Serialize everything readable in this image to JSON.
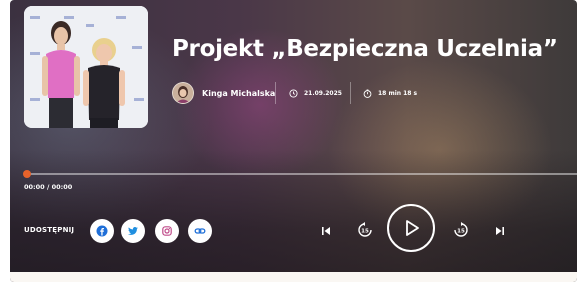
{
  "episode": {
    "title": "Projekt „Bezpieczna Uczelnia”",
    "author": "Kinga Michalska",
    "date": "21.09.2025",
    "duration": "18 min 18 s"
  },
  "player": {
    "time_readout": "00:00 / 00:00",
    "progress": 0
  },
  "share": {
    "label": "UDOSTĘPNIJ",
    "buttons": [
      {
        "name": "facebook",
        "icon": "facebook-icon"
      },
      {
        "name": "twitter",
        "icon": "twitter-icon"
      },
      {
        "name": "instagram",
        "icon": "instagram-icon"
      },
      {
        "name": "link",
        "icon": "link-icon"
      }
    ]
  },
  "controls": [
    "previous-track",
    "rewind-15",
    "play",
    "forward-15",
    "next-track"
  ],
  "colors": {
    "accent": "#e8632b",
    "share_icon": "#1f6fd8",
    "text": "#ffffff"
  }
}
